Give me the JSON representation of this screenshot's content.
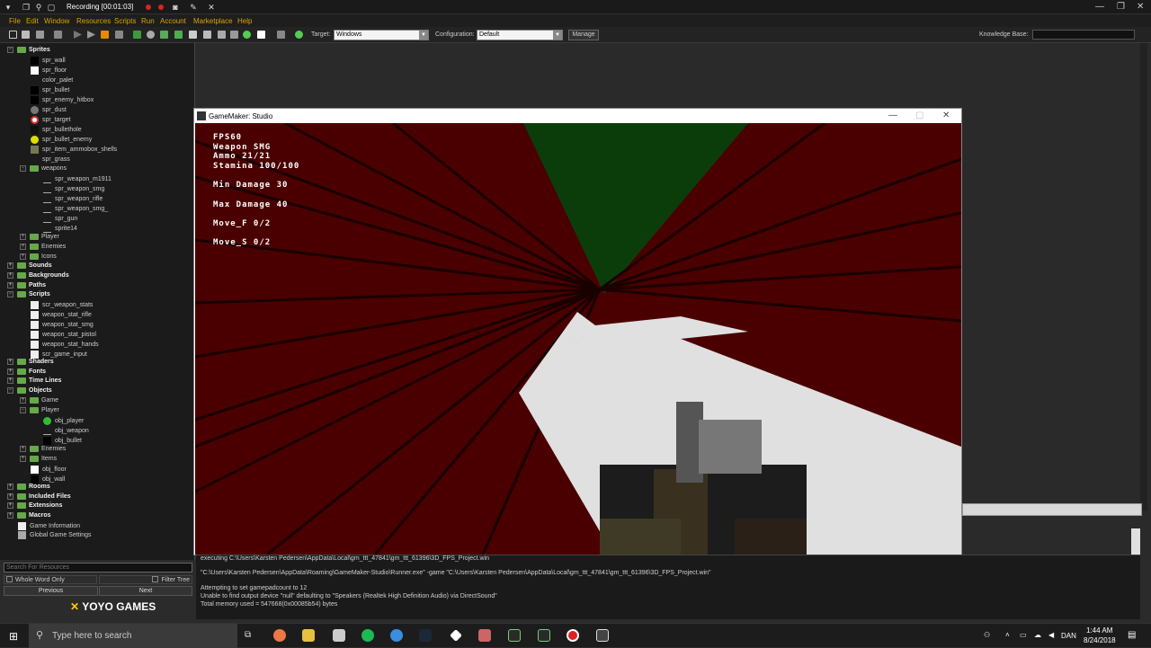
{
  "titlebar": {
    "title": "Recording [00:01:03]"
  },
  "menubar": {
    "items": [
      "File",
      "Edit",
      "Window",
      "Resources",
      "Scripts",
      "Run",
      "Account",
      "Marketplace",
      "Help"
    ]
  },
  "toolbar": {
    "target_label": "Target:",
    "target_value": "Windows",
    "config_label": "Configuration:",
    "config_value": "Default",
    "manage_label": "Manage",
    "knowledge_label": "Knowledge Base:"
  },
  "tree": {
    "sprites": "Sprites",
    "spr_wall": "spr_wall",
    "spr_floor": "spr_floor",
    "color_palet": "color_palet",
    "spr_bullet": "spr_bullet",
    "spr_enemy_hitbox": "spr_enemy_hitbox",
    "spr_dust": "spr_dust",
    "spr_target": "spr_target",
    "spr_bullethole": "spr_bullethole",
    "spr_bullet_enemy": "spr_bullet_enemy",
    "spr_item_ammobox_shells": "spr_item_ammobox_shells",
    "spr_grass": "spr_grass",
    "weapons": "weapons",
    "spr_weapon_m1911": "spr_weapon_m1911",
    "spr_weapon_smg": "spr_weapon_smg",
    "spr_weapon_rifle": "spr_weapon_rifle",
    "spr_weapon_smg_": "spr_weapon_smg_",
    "spr_gun": "spr_gun",
    "sprite14": "sprite14",
    "player": "Player",
    "enemies": "Enemies",
    "icons": "Icons",
    "sounds": "Sounds",
    "backgrounds": "Backgrounds",
    "paths": "Paths",
    "scripts": "Scripts",
    "scr_weapon_stats": "scr_weapon_stats",
    "weapon_stat_rifle": "weapon_stat_rifle",
    "weapon_stat_smg": "weapon_stat_smg",
    "weapon_stat_pistol": "weapon_stat_pistol",
    "weapon_stat_hands": "weapon_stat_hands",
    "scr_game_input": "scr_game_input",
    "shaders": "Shaders",
    "fonts": "Fonts",
    "timelines": "Time Lines",
    "objects": "Objects",
    "obj_game": "Game",
    "obj_player_folder": "Player",
    "obj_player": "obj_player",
    "obj_weapon": "obj_weapon",
    "obj_bullet": "obj_bullet",
    "obj_enemies": "Enemies",
    "obj_items": "Items",
    "obj_floor": "obj_floor",
    "obj_wall": "obj_wall",
    "rooms": "Rooms",
    "included_files": "Included Files",
    "extensions": "Extensions",
    "macros": "Macros",
    "game_information": "Game Information",
    "global_game_settings": "Global Game Settings"
  },
  "search": {
    "placeholder": "Search For Resources",
    "whole_word": "Whole Word Only",
    "filter_tree": "Filter Tree",
    "previous": "Previous",
    "next": "Next",
    "logo": "YOYO GAMES"
  },
  "gamewindow": {
    "title": "GameMaker: Studio",
    "hud": {
      "fps": "FPS60",
      "weapon": "Weapon SMG",
      "ammo": "Ammo 21/21",
      "stamina": "Stamina 100/100",
      "min_damage": "Min Damage 30",
      "max_damage": "Max Damage 40",
      "move_f": "Move_F 0/2",
      "move_s": "Move_S 0/2"
    }
  },
  "output": {
    "line1": "executing C:\\Users\\Karsten Pedersen\\AppData\\Local\\gm_ttt_47841\\gm_ttt_61396\\3D_FPS_Project.win",
    "line2": "\"C:\\Users\\Karsten Pedersen\\AppData\\Roaming\\GameMaker-Studio\\Runner.exe\"  -game \"C:\\Users\\Karsten Pedersen\\AppData\\Local\\gm_ttt_47841\\gm_ttt_61396\\3D_FPS_Project.win\"",
    "line3": "Attempting to set gamepadcount to 12",
    "line4": "Unable to find output device \"null\" defaulting to \"Speakers (Realtek High Definition Audio) via DirectSound\"",
    "line5": "Total memory used = 547668(0x00085b54) bytes"
  },
  "taskbar": {
    "search_placeholder": "Type here to search",
    "language": "DAN",
    "time": "1:44 AM",
    "date": "8/24/2018"
  },
  "colors": {
    "menu_text": "#d9a400",
    "scene_red": "#4a0000",
    "floor": "#e0e0e0",
    "sky_green": "#0b3d0b"
  }
}
